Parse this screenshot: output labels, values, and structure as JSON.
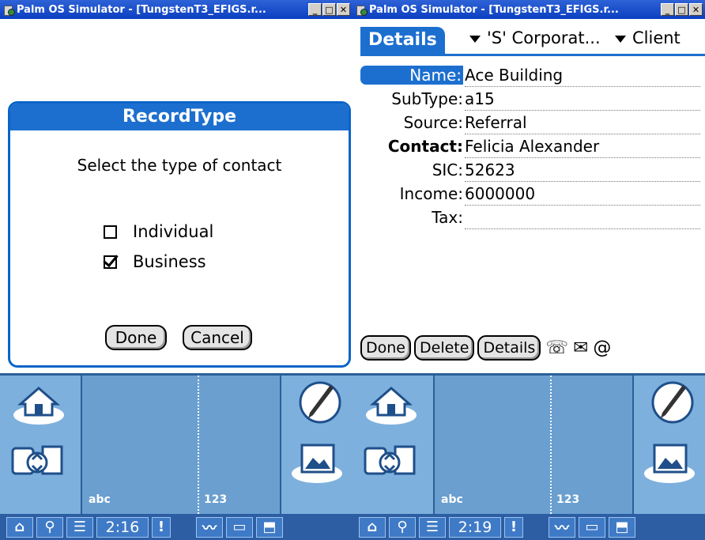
{
  "colors": {
    "accent": "#1c6fcf",
    "titlebar": "#0b3fc1",
    "silk": "#6a9fd0",
    "statusbar": "#2d5ea3"
  },
  "window1": {
    "title": "Palm OS Simulator - [TungstenT3_EFIGS.r...",
    "dialog": {
      "title": "RecordType",
      "prompt": "Select the type of contact",
      "options": [
        {
          "label": "Individual",
          "checked": false
        },
        {
          "label": "Business",
          "checked": true
        }
      ],
      "done_label": "Done",
      "cancel_label": "Cancel"
    },
    "silk": {
      "abc_label": "abc",
      "num_label": "123"
    },
    "status": {
      "time": "2:16"
    }
  },
  "window2": {
    "title": "Palm OS Simulator - [TungstenT3_EFIGS.r...",
    "tab_label": "Details",
    "category_trigger": "'S' Corporat...",
    "type_trigger": "Client",
    "fields": [
      {
        "label": "Name:",
        "value": "Ace Building"
      },
      {
        "label": "SubType:",
        "value": "a15"
      },
      {
        "label": "Source:",
        "value": "Referral"
      },
      {
        "label": "Contact:",
        "value": "Felicia Alexander"
      },
      {
        "label": "SIC:",
        "value": "52623"
      },
      {
        "label": "Income:",
        "value": "6000000"
      },
      {
        "label": "Tax:",
        "value": ""
      }
    ],
    "buttons": {
      "done": "Done",
      "delete": "Delete",
      "details": "Details"
    },
    "icons": {
      "phone": "☏",
      "mail": "✉",
      "at": "@"
    },
    "silk": {
      "abc_label": "abc",
      "num_label": "123"
    },
    "status": {
      "time": "2:19"
    }
  }
}
